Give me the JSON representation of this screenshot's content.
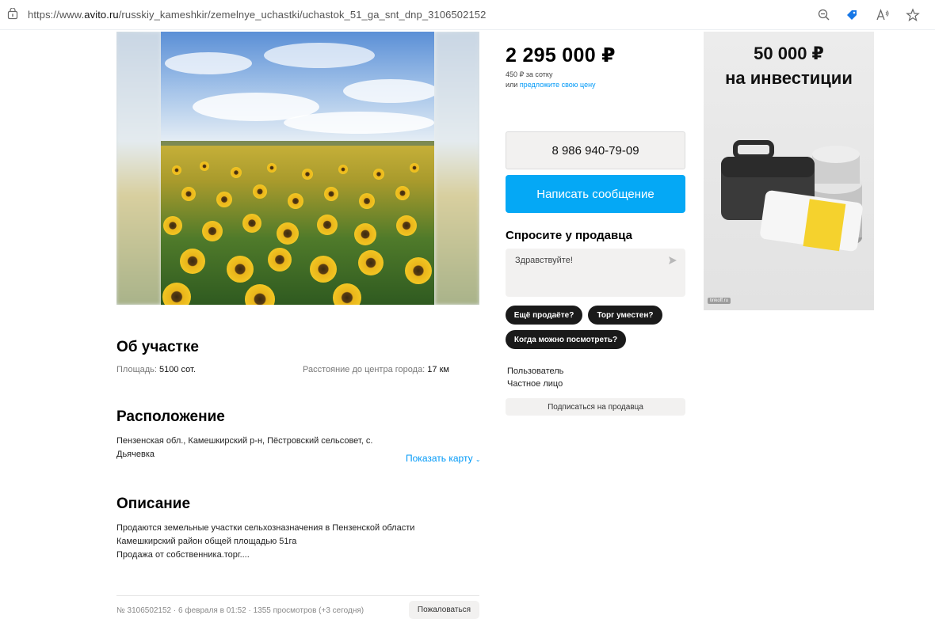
{
  "browser": {
    "url_prefix": "https://www.",
    "url_domain": "avito.ru",
    "url_path": "/russkiy_kameshkir/zemelnye_uchastki/uchastok_51_ga_snt_dnp_3106502152",
    "icons": [
      "site-info-icon",
      "zoom-out-icon",
      "tag-icon",
      "read-aloud-icon",
      "favorite-star-icon"
    ]
  },
  "listing": {
    "price": "2 295 000 ₽",
    "price_per": "450 ₽ за сотку",
    "offer_prefix": "или ",
    "offer_link": "предложите свою цену",
    "phone": "8 986 940-79-09",
    "message_button": "Написать сообщение",
    "ask_title": "Спросите у продавца",
    "ask_text": "Здравствуйте!",
    "chips": [
      "Ещё продаёте?",
      "Торг уместен?",
      "Когда можно посмотреть?"
    ],
    "seller_name": "Пользователь",
    "seller_type": "Частное лицо",
    "subscribe_button": "Подписаться на продавца"
  },
  "about": {
    "title": "Об участке",
    "area_label": "Площадь: ",
    "area_value": "5100 сот.",
    "distance_label": "Расстояние до центра города: ",
    "distance_value": "17 км"
  },
  "location": {
    "title": "Расположение",
    "line1": "Пензенская обл., Камешкирский р-н, Пёстровский сельсовет, с.",
    "line2": "Дьячевка",
    "show_map": "Показать карту"
  },
  "description": {
    "title": "Описание",
    "line1": "Продаются земельные участки сельхозназначения в Пензенской области",
    "line2": "Камешкирский район общей площадью 51га",
    "line3": "Продажа от собственника.торг...."
  },
  "footer": {
    "meta": "№ 3106502152 · 6 февраля в 01:52 · 1355 просмотров (+3 сегодня)",
    "report_button": "Пожаловаться"
  },
  "ad": {
    "amount": "50 000 ₽",
    "text": "на инвестиции",
    "source": "tinkoff.ru"
  },
  "colors": {
    "accent_blue": "#05a8f5",
    "link_blue": "#0099f7",
    "chip_dark": "#1a1a1a",
    "button_gray": "#f2f1f0",
    "ad_yellow": "#f5d22d"
  }
}
